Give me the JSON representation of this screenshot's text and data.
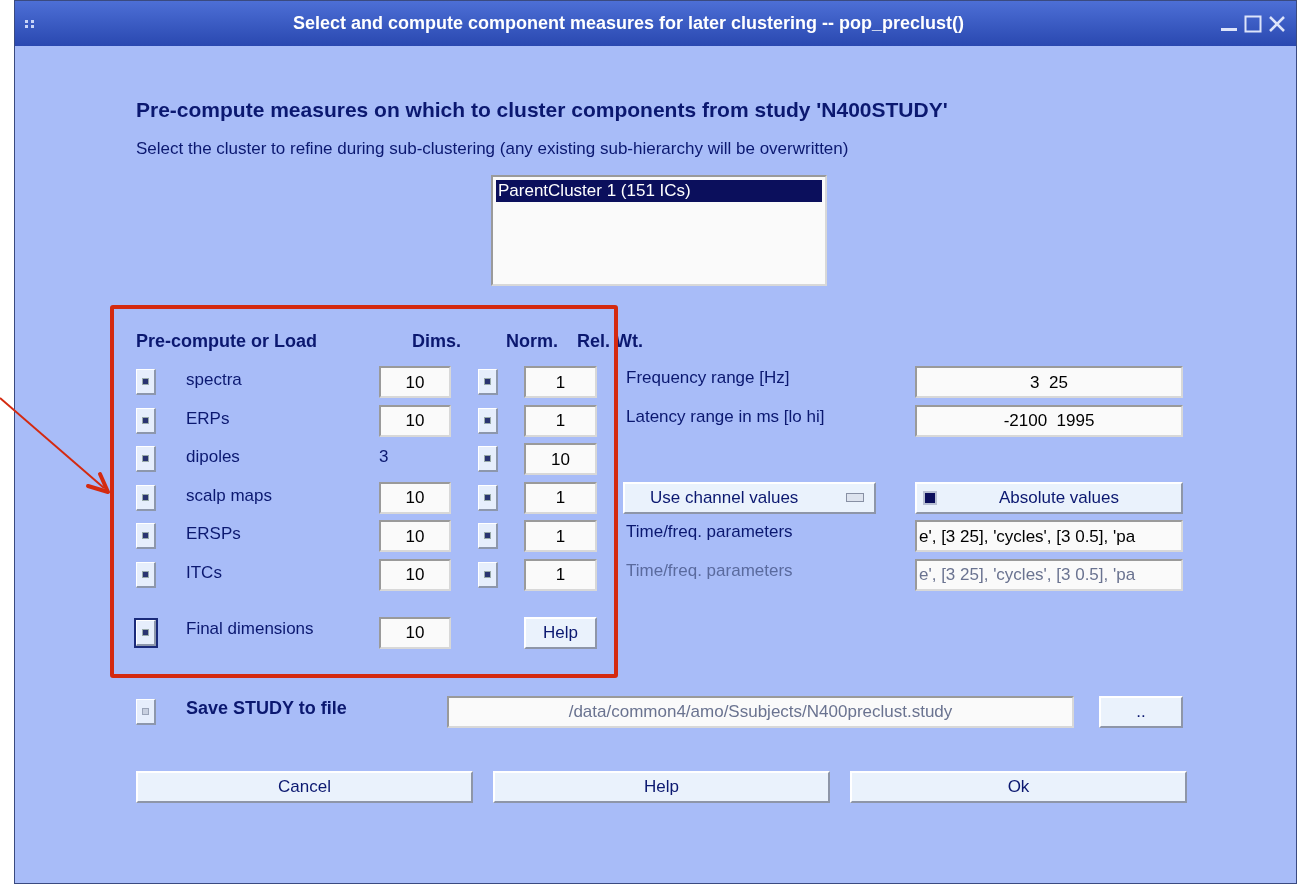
{
  "window": {
    "title": "Select and compute component measures for later clustering -- pop_preclust()"
  },
  "heading": "Pre-compute measures on which to cluster components from study 'N400STUDY'",
  "subheading": "Select the cluster to refine during sub-clustering (any existing sub-hierarchy will be overwritten)",
  "cluster_list": [
    {
      "label": "ParentCluster 1 (151 ICs)",
      "selected": true
    }
  ],
  "measures_header": {
    "column_1": "Pre-compute or Load",
    "column_2": "Dims.",
    "column_3": "Norm.",
    "column_4": "Rel. Wt."
  },
  "measures": [
    {
      "label": "spectra",
      "checked": true,
      "dims": {
        "kind": "field",
        "value": "10"
      },
      "norm_checked": true,
      "weight": "1",
      "option": {
        "kind": "field",
        "label": "Frequency range [Hz]",
        "value": "3  25",
        "disabled": false
      }
    },
    {
      "label": "ERPs",
      "checked": true,
      "dims": {
        "kind": "field",
        "value": "10"
      },
      "norm_checked": true,
      "weight": "1",
      "option": {
        "kind": "field",
        "label": "Latency range in ms [lo hi]",
        "value": "-2100  1995",
        "disabled": false
      }
    },
    {
      "label": "dipoles",
      "checked": true,
      "dims": {
        "kind": "text",
        "value": "3"
      },
      "norm_checked": true,
      "weight": "10"
    },
    {
      "label": "scalp maps",
      "checked": true,
      "dims": {
        "kind": "field",
        "value": "10"
      },
      "norm_checked": true,
      "weight": "1",
      "option": {
        "kind": "choices",
        "popup": "Use channel values",
        "toggle": {
          "label": "Absolute values",
          "checked": true
        }
      }
    },
    {
      "label": "ERSPs",
      "checked": true,
      "dims": {
        "kind": "field",
        "value": "10"
      },
      "norm_checked": true,
      "weight": "1",
      "option": {
        "kind": "field",
        "label": "Time/freq. parameters",
        "value": "e', [3 25], 'cycles', [3 0.5], 'pa",
        "disabled": false
      }
    },
    {
      "label": "ITCs",
      "checked": true,
      "dims": {
        "kind": "field",
        "value": "10"
      },
      "norm_checked": true,
      "weight": "1",
      "option": {
        "kind": "field",
        "label": "Time/freq. parameters",
        "value": "e', [3 25], 'cycles', [3 0.5], 'pa",
        "disabled": true
      }
    }
  ],
  "final": {
    "label": "Final dimensions",
    "checked": true,
    "value": "10",
    "help": "Help"
  },
  "save": {
    "label": "Save STUDY to file",
    "checked": false,
    "path": "/data/common4/amo/Ssubjects/N400preclust.study",
    "path_disabled": true,
    "browse": ".."
  },
  "buttons": [
    "Cancel",
    "Help",
    "Ok"
  ]
}
